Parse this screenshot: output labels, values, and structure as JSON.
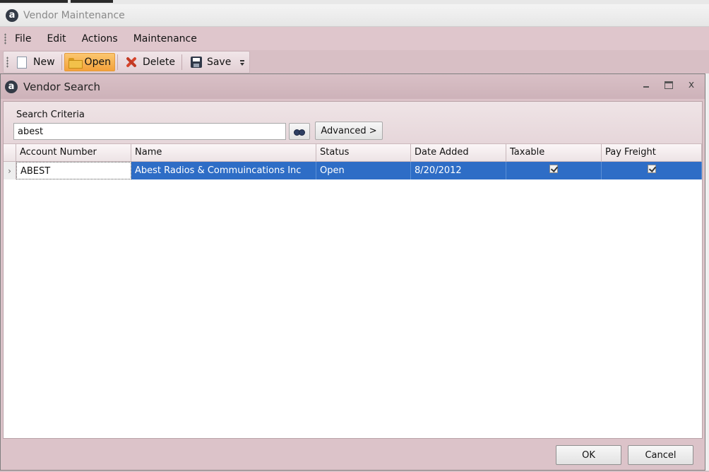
{
  "parent_window": {
    "title": "Vendor Maintenance"
  },
  "app_icon_letter": "a",
  "menubar": {
    "items": [
      "File",
      "Edit",
      "Actions",
      "Maintenance"
    ]
  },
  "toolbar": {
    "new_label": "New",
    "open_label": "Open",
    "delete_label": "Delete",
    "save_label": "Save"
  },
  "dialog": {
    "title": "Vendor Search",
    "search_criteria_label": "Search Criteria",
    "search_value": "abest",
    "advanced_label": "Advanced >",
    "ok_label": "OK",
    "cancel_label": "Cancel"
  },
  "grid": {
    "columns": [
      "Account Number",
      "Name",
      "Status",
      "Date Added",
      "Taxable",
      "Pay Freight"
    ],
    "rows": [
      {
        "account_number": "ABEST",
        "name": "Abest Radios & Commuincations Inc",
        "status": "Open",
        "date_added": "8/20/2012",
        "taxable": true,
        "pay_freight": true
      }
    ],
    "selected_row_color": "#2e6dc6"
  },
  "colors": {
    "window_accent": "#dcc3c9",
    "active_toolbar_button": "#f3a13a"
  }
}
